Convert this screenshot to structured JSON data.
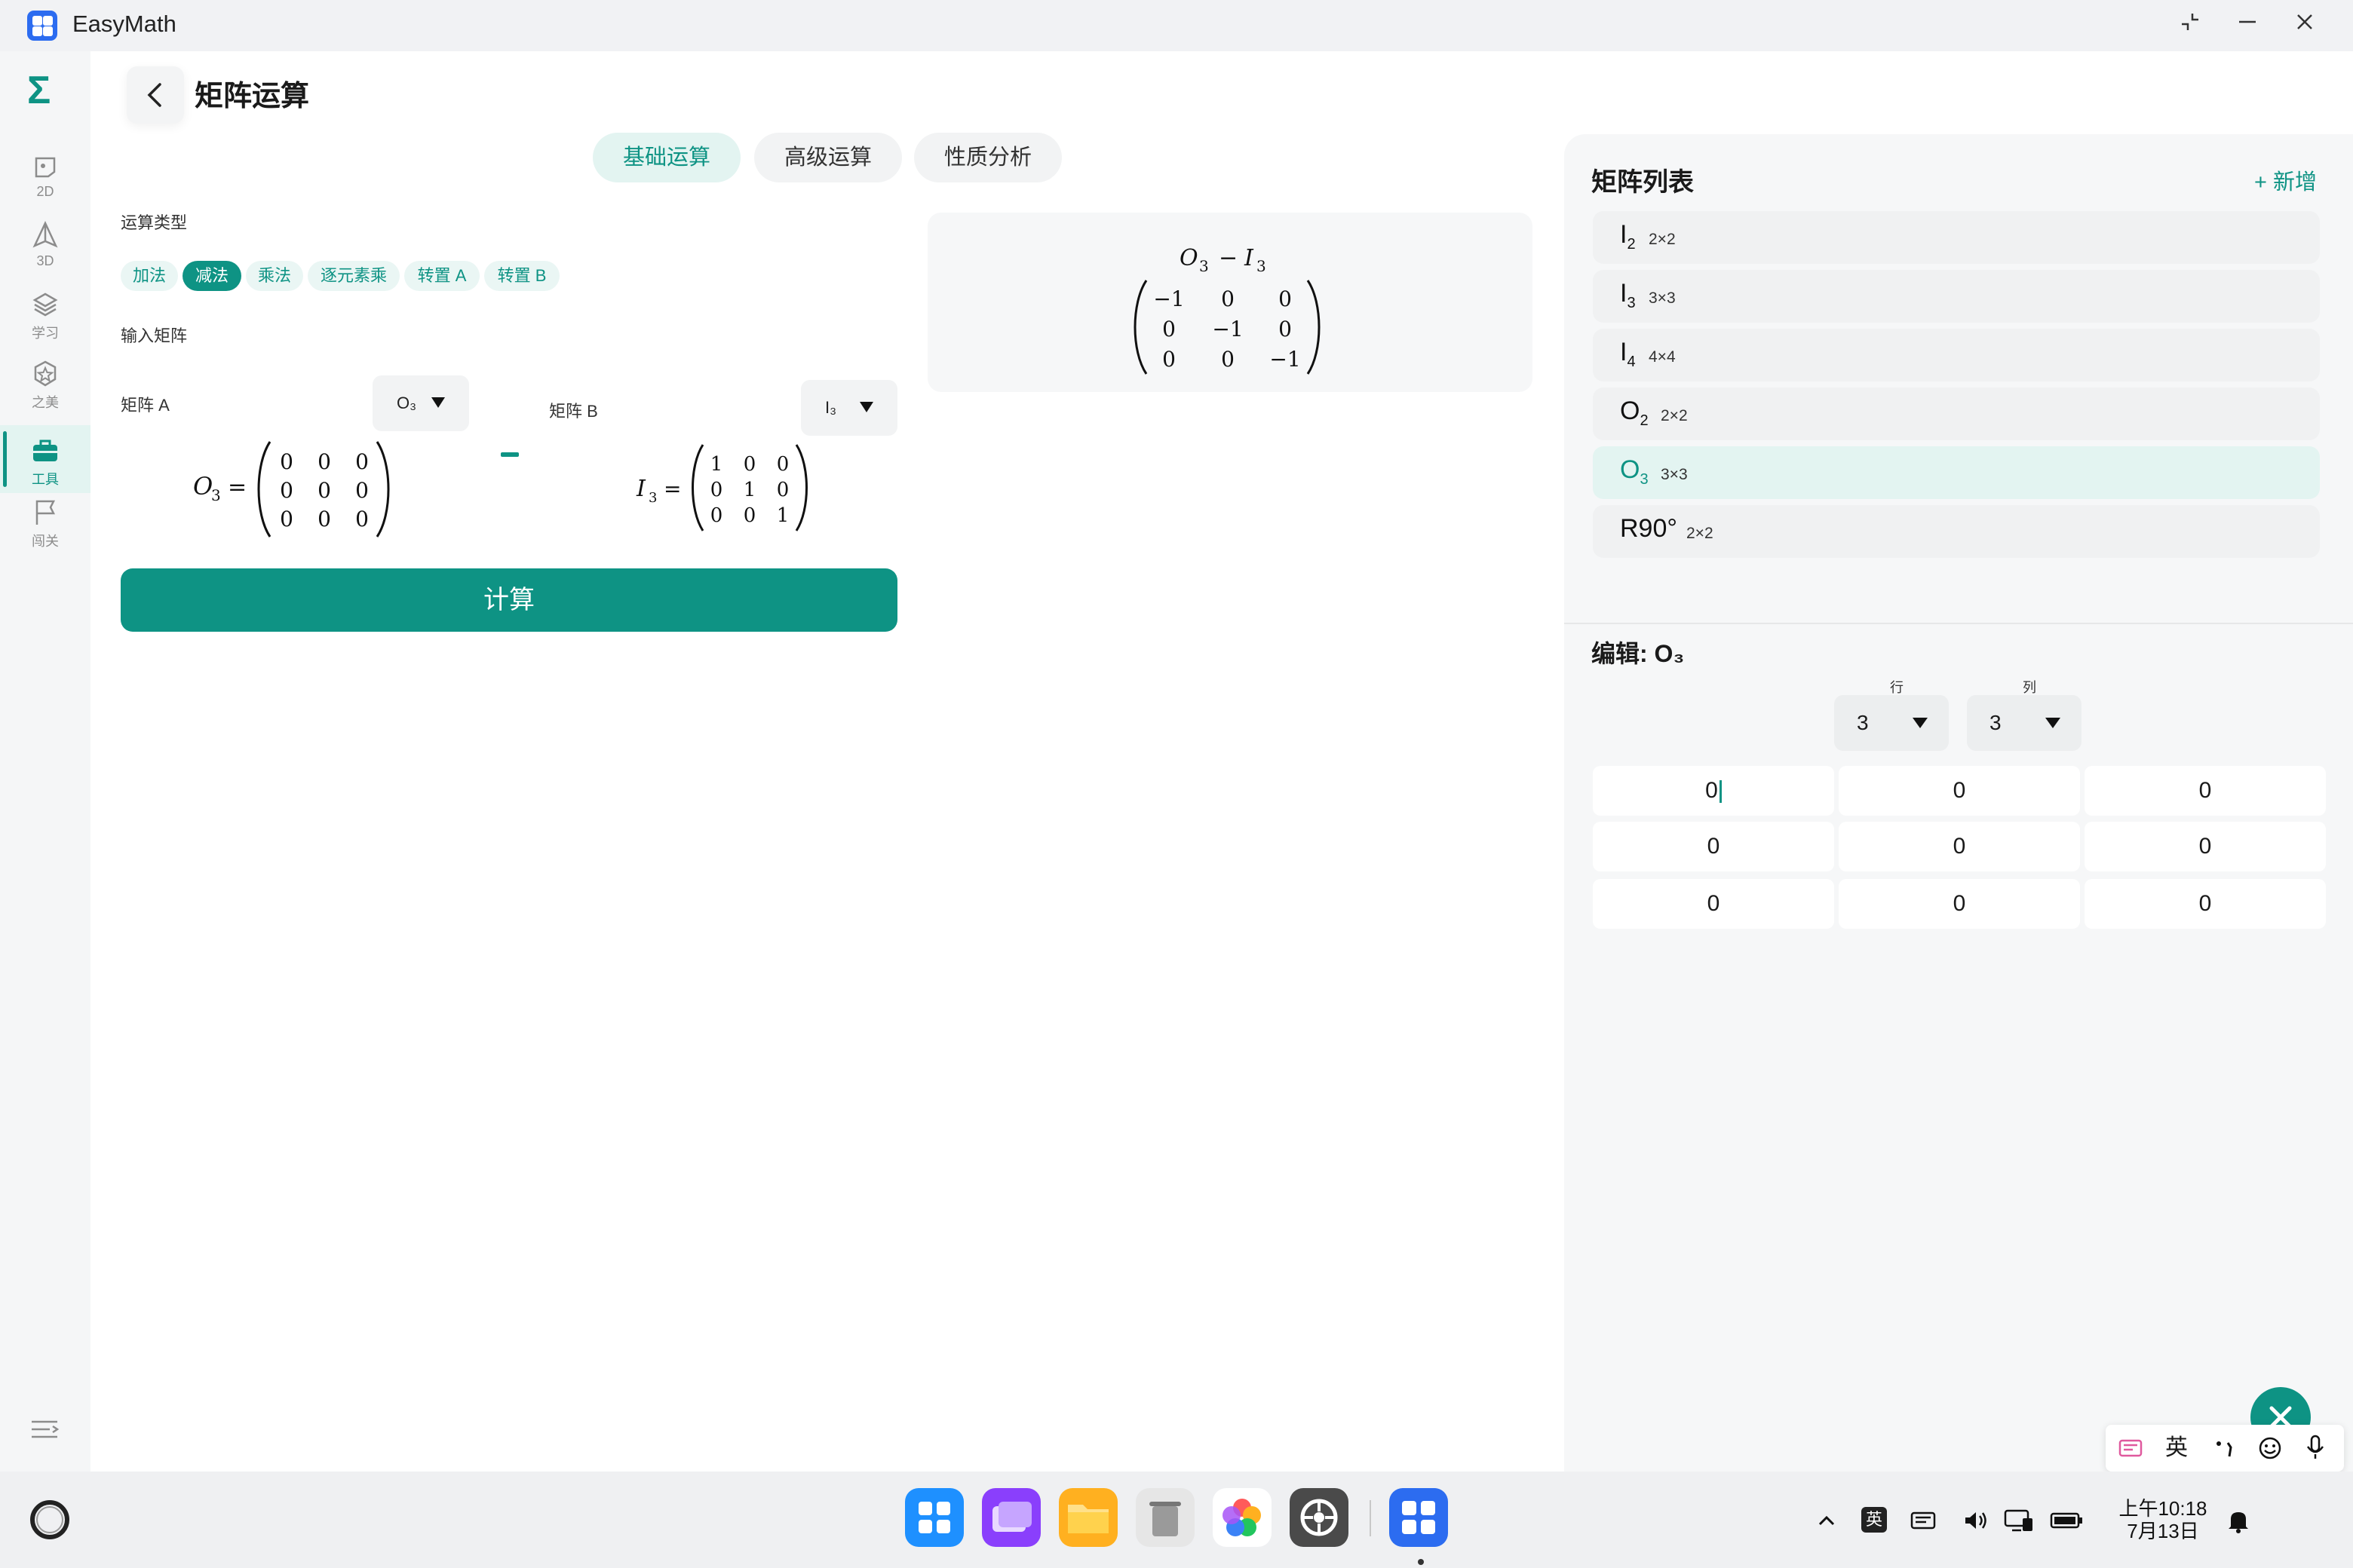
{
  "window": {
    "title": "EasyMath",
    "restore_icon": "restore-icon",
    "minimize_icon": "minimize-icon",
    "close_icon": "close-icon"
  },
  "sidebar": {
    "logo_glyph": "Σ",
    "items": [
      {
        "label": "2D",
        "icon": "2d-shape-icon",
        "active": false
      },
      {
        "label": "3D",
        "icon": "3d-pyramid-icon",
        "active": false
      },
      {
        "label": "学习",
        "icon": "layers-icon",
        "active": false
      },
      {
        "label": "之美",
        "icon": "star-badge-icon",
        "active": false
      },
      {
        "label": "工具",
        "icon": "toolbox-icon",
        "active": true
      },
      {
        "label": "闯关",
        "icon": "flag-icon",
        "active": false
      }
    ]
  },
  "header": {
    "title": "矩阵运算"
  },
  "tabs": [
    {
      "label": "基础运算",
      "active": true
    },
    {
      "label": "高级运算",
      "active": false
    },
    {
      "label": "性质分析",
      "active": false
    }
  ],
  "operation": {
    "type_label": "运算类型",
    "types": [
      "加法",
      "减法",
      "乘法",
      "逐元素乘",
      "转置 A",
      "转置 B"
    ],
    "selected": "减法"
  },
  "input": {
    "label": "输入矩阵",
    "matrix_a": {
      "label": "矩阵 A",
      "select_value": "O₃",
      "name": "O",
      "sub": "3",
      "rows": [
        [
          "0",
          "0",
          "0"
        ],
        [
          "0",
          "0",
          "0"
        ],
        [
          "0",
          "0",
          "0"
        ]
      ]
    },
    "matrix_b": {
      "label": "矩阵 B",
      "select_value": "I₃",
      "name": "I",
      "sub": "3",
      "rows": [
        [
          "1",
          "0",
          "0"
        ],
        [
          "0",
          "1",
          "0"
        ],
        [
          "0",
          "0",
          "1"
        ]
      ]
    },
    "operator": "−"
  },
  "calculate_label": "计算",
  "result": {
    "a_name": "O",
    "a_sub": "3",
    "op": "−",
    "b_name": "I",
    "b_sub": "3",
    "rows": [
      [
        "−1",
        "0",
        "0"
      ],
      [
        "0",
        "−1",
        "0"
      ],
      [
        "0",
        "0",
        "−1"
      ]
    ]
  },
  "panel": {
    "title": "矩阵列表",
    "add_label": "+ 新增",
    "matrices": [
      {
        "name": "I",
        "sub": "2",
        "dims": "2×2",
        "selected": false
      },
      {
        "name": "I",
        "sub": "3",
        "dims": "3×3",
        "selected": false
      },
      {
        "name": "I",
        "sub": "4",
        "dims": "4×4",
        "selected": false
      },
      {
        "name": "O",
        "sub": "2",
        "dims": "2×2",
        "selected": false
      },
      {
        "name": "O",
        "sub": "3",
        "dims": "3×3",
        "selected": true
      },
      {
        "name": "R90°",
        "sub": "",
        "dims": "2×2",
        "selected": false
      }
    ],
    "edit": {
      "title": "编辑: O₃",
      "row_label": "行",
      "col_label": "列",
      "rows_value": "3",
      "cols_value": "3",
      "cells": [
        [
          "0",
          "0",
          "0"
        ],
        [
          "0",
          "0",
          "0"
        ],
        [
          "0",
          "0",
          "0"
        ]
      ]
    }
  },
  "ime": {
    "items": [
      "keyboard-icon",
      "英",
      "punct-icon",
      "emoji-icon",
      "mic-icon"
    ]
  },
  "taskbar": {
    "apps": [
      "app-launcher-icon",
      "multitask-icon",
      "files-icon",
      "trash-icon",
      "photos-icon",
      "settings-icon",
      "easymath-icon"
    ],
    "tray": {
      "lang": "英",
      "time": "上午10:18",
      "date": "7月13日"
    }
  },
  "colors": {
    "accent": "#0e9384",
    "accent_light": "#e3f4f1"
  }
}
